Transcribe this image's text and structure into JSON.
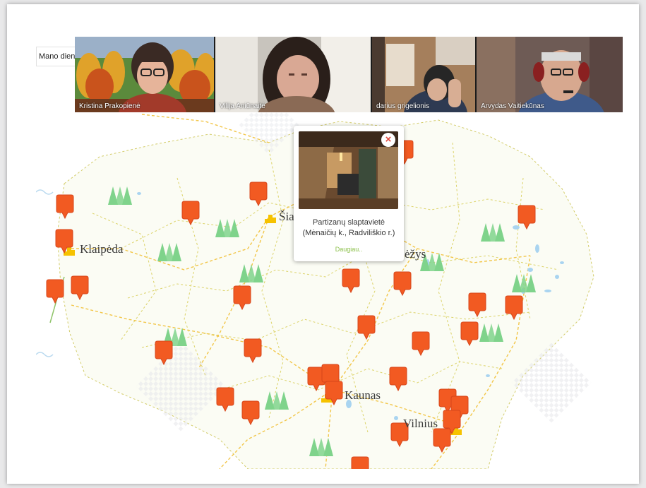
{
  "tab": {
    "label": "Mano dieny"
  },
  "participants": [
    {
      "name": "Kristina Prakopienė",
      "bg": "#c95a16"
    },
    {
      "name": "Vilija Aniūnaitė",
      "bg": "#8a8e90"
    },
    {
      "name": "darius grigelionis",
      "bg": "#b58c6a"
    },
    {
      "name": "Arvydas Vaitiekūnas",
      "bg": "#6e5b55"
    }
  ],
  "cities": [
    {
      "id": "klaipeda",
      "name": "Klaipėda"
    },
    {
      "id": "siauliai",
      "name": "Šia"
    },
    {
      "id": "panevezys",
      "name": "ėžys"
    },
    {
      "id": "kaunas",
      "name": "Kaunas"
    },
    {
      "id": "vilnius",
      "name": "Vilnius"
    }
  ],
  "popup": {
    "title": "Partizanų slaptavietė (Mėnaičių k., Radviliškio r.)",
    "more": "Daugiau..",
    "close_icon": "close-icon"
  },
  "colors": {
    "marker": "#f25a22",
    "marker_dark": "#d7461b",
    "border": "#dcd36a",
    "tree": "#7fd38b",
    "water": "#a9d4f0",
    "city_icon": "#f6c200",
    "more_link": "#8cc04b"
  }
}
